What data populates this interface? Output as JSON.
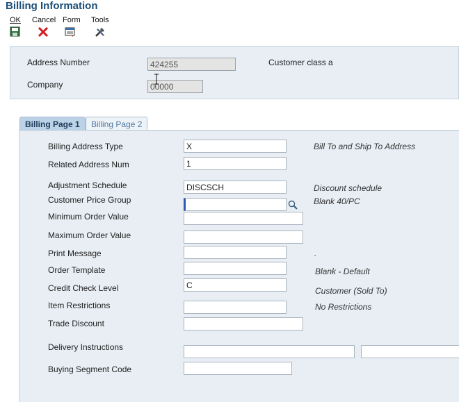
{
  "window": {
    "title": "Billing Information"
  },
  "toolbar": {
    "ok_label": "OK",
    "cancel_label": "Cancel",
    "form_label": "Form",
    "tools_label": "Tools"
  },
  "header": {
    "address_number_label": "Address Number",
    "address_number_value": "424255",
    "customer_class_text": "Customer class a",
    "company_label": "Company",
    "company_value": "00000"
  },
  "tabs": [
    {
      "label": "Billing Page 1",
      "active": true
    },
    {
      "label": "Billing Page 2",
      "active": false
    }
  ],
  "form": {
    "billing_address_type": {
      "label": "Billing Address Type",
      "value": "X",
      "desc": "Bill To and Ship To Address"
    },
    "related_address_num": {
      "label": "Related Address Num",
      "value": "1"
    },
    "adjustment_schedule": {
      "label": "Adjustment Schedule",
      "value": "DISCSCH",
      "desc": "Discount schedule"
    },
    "customer_price_group": {
      "label": "Customer Price Group",
      "value": "",
      "desc": "Blank 40/PC"
    },
    "minimum_order_value": {
      "label": "Minimum Order Value",
      "value": ""
    },
    "maximum_order_value": {
      "label": "Maximum Order Value",
      "value": ""
    },
    "print_message": {
      "label": "Print Message",
      "value": "",
      "desc": "."
    },
    "order_template": {
      "label": "Order Template",
      "value": "",
      "desc": "Blank - Default"
    },
    "credit_check_level": {
      "label": "Credit Check Level",
      "value": "C",
      "desc": "Customer (Sold To)"
    },
    "item_restrictions": {
      "label": "Item Restrictions",
      "value": "",
      "desc": "No Restrictions"
    },
    "trade_discount": {
      "label": "Trade Discount",
      "value": ""
    },
    "delivery_instructions": {
      "label": "Delivery Instructions",
      "value1": "",
      "value2": ""
    },
    "buying_segment_code": {
      "label": "Buying Segment Code",
      "value": ""
    }
  },
  "colors": {
    "title": "#1c4f78",
    "panel": "#e8eef4",
    "active_tab": "#bcd2e6"
  }
}
